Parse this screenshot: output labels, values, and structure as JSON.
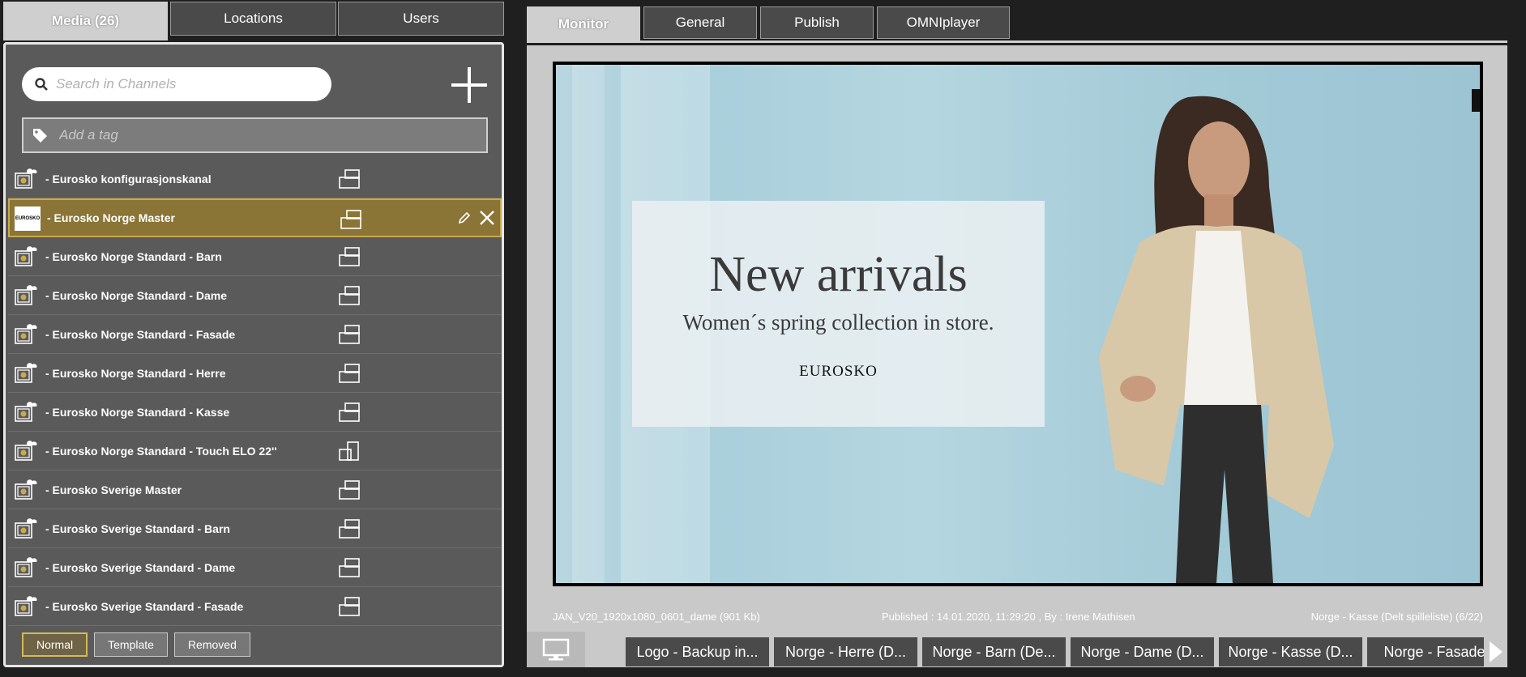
{
  "left_tabs": [
    "Media (26)",
    "Locations",
    "Users"
  ],
  "search": {
    "placeholder": "Search in Channels",
    "value": ""
  },
  "tag": {
    "placeholder": "Add a tag",
    "value": ""
  },
  "channels": [
    {
      "name": "- Eurosko konfigurasjonskanal",
      "orientation": "landscape",
      "selected": false
    },
    {
      "name": "- Eurosko Norge Master",
      "orientation": "landscape",
      "selected": true,
      "logo": "EUROSKO"
    },
    {
      "name": "- Eurosko Norge Standard - Barn",
      "orientation": "landscape",
      "selected": false
    },
    {
      "name": "- Eurosko Norge Standard - Dame",
      "orientation": "landscape",
      "selected": false
    },
    {
      "name": "- Eurosko Norge Standard - Fasade",
      "orientation": "landscape",
      "selected": false
    },
    {
      "name": "- Eurosko Norge Standard - Herre",
      "orientation": "landscape",
      "selected": false
    },
    {
      "name": "- Eurosko Norge Standard - Kasse",
      "orientation": "landscape",
      "selected": false
    },
    {
      "name": "- Eurosko Norge Standard - Touch ELO 22''",
      "orientation": "portrait",
      "selected": false
    },
    {
      "name": "- Eurosko Sverige Master",
      "orientation": "landscape",
      "selected": false
    },
    {
      "name": "- Eurosko Sverige Standard - Barn",
      "orientation": "landscape",
      "selected": false
    },
    {
      "name": "- Eurosko Sverige Standard - Dame",
      "orientation": "landscape",
      "selected": false
    },
    {
      "name": "- Eurosko Sverige Standard - Fasade",
      "orientation": "landscape",
      "selected": false
    }
  ],
  "filters": [
    "Normal",
    "Template",
    "Removed"
  ],
  "active_filter": "Normal",
  "right_tabs": [
    "Monitor",
    "General",
    "Publish",
    "OMNIplayer"
  ],
  "ad": {
    "headline": "New arrivals",
    "subline": "Women´s spring collection in store.",
    "brand": "EUROSKO"
  },
  "meta": {
    "file": "JAN_V20_1920x1080_0601_dame (901 Kb)",
    "published": "Published : 14.01.2020, 11:29:20 , By : Irene Mathisen",
    "playlist": "Norge - Kasse (Delt spilleliste)  (6/22)"
  },
  "playlists": [
    "Logo - Backup in...",
    "Norge - Herre (D...",
    "Norge - Barn (De...",
    "Norge - Dame (D...",
    "Norge - Kasse (D...",
    "Norge - Fasade ("
  ],
  "colors": {
    "selected_row": "#8a7536",
    "accent_border": "#c9a94a",
    "panel": "#5a5a5a"
  }
}
